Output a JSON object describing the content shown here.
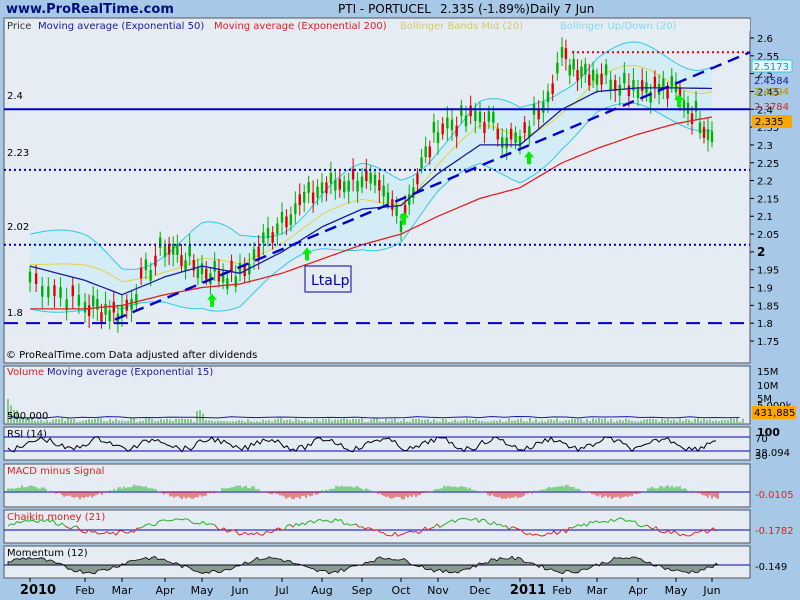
{
  "header": {
    "site": "www.ProRealTime.com",
    "instrument": "PTI - PORTUCEL",
    "quote": "2.335 (-1.89%)",
    "period": "Daily  7 Jun"
  },
  "legend_main": {
    "price": "Price",
    "ma50": "Moving average (Exponential 50)",
    "ma200": "Moving average (Exponential 200)",
    "bollinger_mid": "Bollinger Bands Mid (20)",
    "bollinger_up_down": "Bollinger Up/Down (20)"
  },
  "annotations": {
    "credit": "© ProRealTime.com Data adjusted after dividends",
    "pattern_label": "LtaLp",
    "level_labels": [
      "2.4",
      "2.23",
      "2.02",
      "1.8"
    ]
  },
  "price_value_labels": [
    "2.5173",
    "2.4584",
    "2.4294",
    "2.3784",
    "2.335"
  ],
  "price_axis_ticks": [
    "2.6",
    "2.55",
    "2.5",
    "2.45",
    "2.4",
    "2.35",
    "2.3",
    "2.25",
    "2.2",
    "2.15",
    "2.1",
    "2.05",
    "2",
    "1.95",
    "1.9",
    "1.85",
    "1.8",
    "1.75"
  ],
  "x_axis_ticks": [
    "2010",
    "Feb",
    "Mar",
    "Apr",
    "May",
    "Jun",
    "Jul",
    "Aug",
    "Sep",
    "Oct",
    "Nov",
    "Dec",
    "2011",
    "Feb",
    "Mar",
    "Apr",
    "May",
    "Jun"
  ],
  "volume_panel": {
    "legend_volume": "Volume",
    "legend_ma": "Moving average (Exponential 15)",
    "left_label": "500,000",
    "axis_ticks": [
      "15M",
      "10M",
      "5M",
      "5,000k"
    ],
    "value_label": "431,885"
  },
  "rsi_panel": {
    "label": "RSI (14)",
    "axis_ticks": [
      "100",
      "70",
      "30"
    ],
    "value_label": "28.094"
  },
  "macd_panel": {
    "label": "MACD minus Signal",
    "value_label": "-0.0105"
  },
  "chaikin_panel": {
    "label": "Chaikin money (21)",
    "value_label": "-0.1782"
  },
  "momentum_panel": {
    "label": "Momentum (12)",
    "value_label": "-0.149"
  },
  "colors": {
    "background": "#a8c8e8",
    "panel": "#e8eef6",
    "ma50": "#1a1a9a",
    "ma200": "#e02020",
    "bollinger": "#30c8e8",
    "bollinger_mid": "#e8d040",
    "level_line": "#0000c8",
    "arrow": "#00ee00",
    "resistance": "#e00000",
    "candle_up": "#00b000",
    "candle_down": "#e00000"
  },
  "chart_data": {
    "type": "line",
    "title": "PTI - PORTUCEL",
    "x": [
      "2010",
      "Feb",
      "Mar",
      "Apr",
      "May",
      "Jun",
      "Jul",
      "Aug",
      "Sep",
      "Oct",
      "Nov",
      "Dec",
      "2011",
      "Feb",
      "Mar",
      "Apr",
      "May",
      "Jun"
    ],
    "ylim": [
      1.72,
      2.64
    ],
    "horizontal_levels": [
      2.4,
      2.23,
      2.02,
      1.8
    ],
    "resistance_level": 2.56,
    "series": [
      {
        "name": "Price",
        "values": [
          1.93,
          1.85,
          1.83,
          2.02,
          1.95,
          1.93,
          2.1,
          2.18,
          2.21,
          2.1,
          2.35,
          2.38,
          2.3,
          2.54,
          2.5,
          2.47,
          2.45,
          2.335
        ]
      },
      {
        "name": "Moving average (Exponential 50)",
        "values": [
          1.96,
          1.92,
          1.88,
          1.93,
          1.96,
          1.94,
          2.0,
          2.07,
          2.12,
          2.13,
          2.22,
          2.3,
          2.3,
          2.4,
          2.45,
          2.46,
          2.46,
          2.4584
        ]
      },
      {
        "name": "Moving average (Exponential 200)",
        "values": [
          1.84,
          1.84,
          1.85,
          1.88,
          1.9,
          1.91,
          1.94,
          1.98,
          2.02,
          2.05,
          2.1,
          2.15,
          2.18,
          2.25,
          2.29,
          2.33,
          2.36,
          2.3784
        ]
      }
    ],
    "last_values": {
      "price": 2.335,
      "ma50": 2.4584,
      "ma200": 2.3784,
      "bollinger_up": 2.5173,
      "bollinger_mid": 2.4294
    }
  }
}
